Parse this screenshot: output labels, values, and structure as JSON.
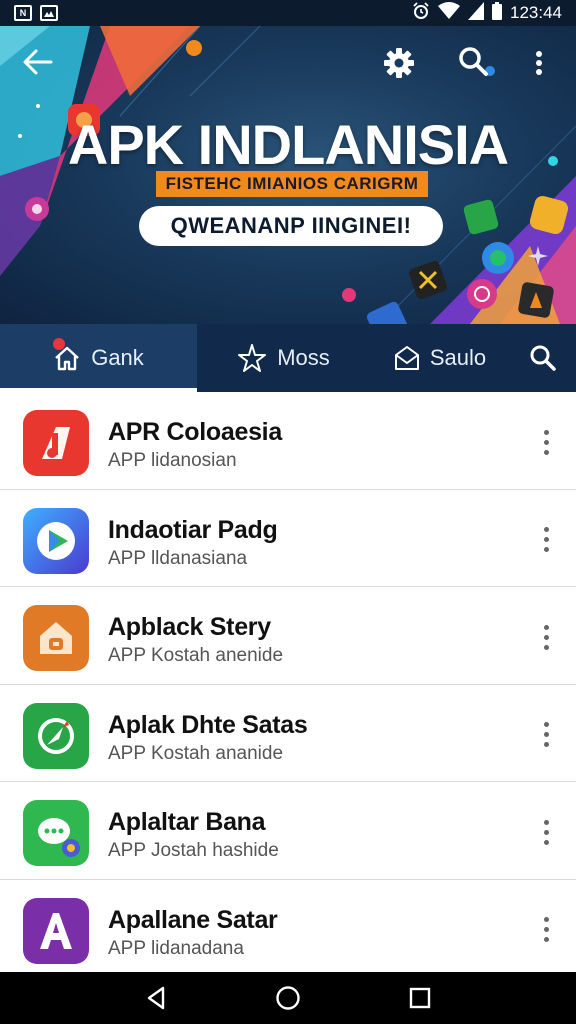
{
  "status_bar": {
    "time": "12:3:44",
    "time_display": "123:44"
  },
  "hero": {
    "title": "APK INDLANISIA",
    "subtitle": "FISTEHC IMIANIOS CARIGRM",
    "pill": "QWEANANP IINGINEI!"
  },
  "tabs": [
    {
      "label": "Gank",
      "icon": "home-icon",
      "active": true
    },
    {
      "label": "Moss",
      "icon": "star-icon",
      "active": false
    },
    {
      "label": "Saulo",
      "icon": "envelope-icon",
      "active": false
    }
  ],
  "apps": [
    {
      "name": "APR Coloaesia",
      "subtitle": "APP lidanosian",
      "icon": "music-note-icon",
      "color": "#e8372e"
    },
    {
      "name": "Indaotiar Padg",
      "subtitle": "APP lldanasiana",
      "icon": "play-store-icon",
      "color": "#3b5fd6"
    },
    {
      "name": "Apblack Stery",
      "subtitle": "APP Kostah anenide",
      "icon": "house-icon",
      "color": "#e07a26"
    },
    {
      "name": "Aplak Dhte Satas",
      "subtitle": "APP Kostah ananide",
      "icon": "compass-icon",
      "color": "#27a547"
    },
    {
      "name": "Aplaltar Bana",
      "subtitle": "APP Jostah hashide",
      "icon": "chat-bubble-icon",
      "color": "#2eb84f"
    },
    {
      "name": "Apallane Satar",
      "subtitle": "APP lidanadana",
      "icon": "letter-a-icon",
      "color": "#7a2fa8"
    }
  ],
  "colors": {
    "tab_bar": "#11294a",
    "tab_active": "#1c3d66",
    "subtitle_band": "#f08a1c"
  }
}
